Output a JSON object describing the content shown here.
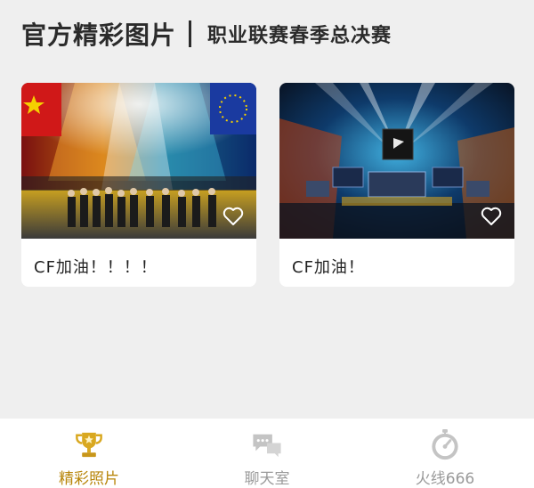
{
  "header": {
    "title": "官方精彩图片",
    "subtitle": "职业联赛春季总决赛"
  },
  "cards": [
    {
      "caption": "CF加油！！！！",
      "icon": "heart-outline-icon"
    },
    {
      "caption": "CF加油！",
      "icon": "heart-outline-icon"
    }
  ],
  "nav": {
    "items": [
      {
        "label": "精彩照片",
        "icon": "trophy-icon",
        "active": true
      },
      {
        "label": "聊天室",
        "icon": "chat-bubbles-icon",
        "active": false
      },
      {
        "label": "火线666",
        "icon": "stopwatch-icon",
        "active": false
      }
    ]
  },
  "colors": {
    "background": "#efefef",
    "accent": "#b8860b",
    "inactive": "#9a9a9a",
    "text": "#2b2b2b"
  }
}
